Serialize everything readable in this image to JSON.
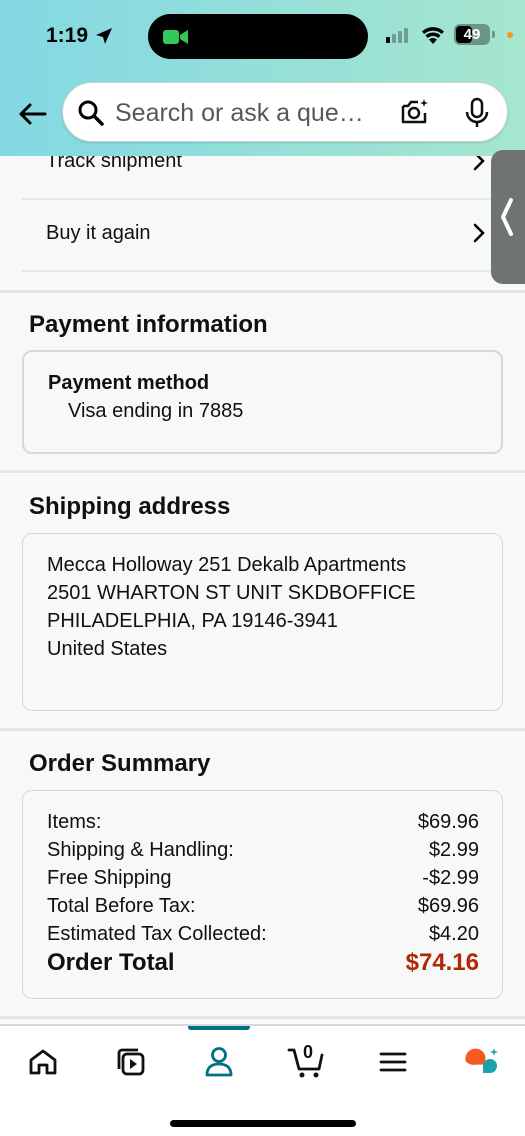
{
  "status_bar": {
    "time": "1:19",
    "battery": "49",
    "battery_fraction": 0.49
  },
  "search": {
    "placeholder": "Search or ask a que…"
  },
  "order_links": [
    {
      "label": "Track shipment"
    },
    {
      "label": "Buy it again"
    }
  ],
  "payment": {
    "title": "Payment information",
    "method_heading": "Payment method",
    "method_value": "Visa  ending in 7885"
  },
  "shipping": {
    "title": "Shipping address",
    "lines": [
      "Mecca Holloway 251 Dekalb Apartments",
      "2501 WHARTON ST UNIT SKDBOFFICE",
      "PHILADELPHIA, PA 19146-3941",
      "United States"
    ]
  },
  "summary": {
    "title": "Order Summary",
    "rows": [
      {
        "label": "Items:",
        "value": "$69.96"
      },
      {
        "label": "Shipping & Handling:",
        "value": "$2.99"
      },
      {
        "label": "Free Shipping",
        "value": "-$2.99"
      },
      {
        "label": "Total Before Tax:",
        "value": "$69.96"
      },
      {
        "label": "Estimated Tax Collected:",
        "value": "$4.20"
      }
    ],
    "total_label": "Order Total",
    "total_value": "$74.16"
  },
  "bottom_nav": {
    "items": [
      {
        "icon": "home-icon"
      },
      {
        "icon": "video-icon"
      },
      {
        "icon": "account-icon",
        "active": true
      },
      {
        "icon": "cart-icon"
      },
      {
        "icon": "menu-icon"
      },
      {
        "icon": "rufus-icon"
      }
    ],
    "cart_count": "0"
  },
  "colors": {
    "accent": "#007185",
    "total_red": "#b12704",
    "header_gradient_start": "#82d8e3",
    "header_gradient_end": "#a6e6ce"
  }
}
